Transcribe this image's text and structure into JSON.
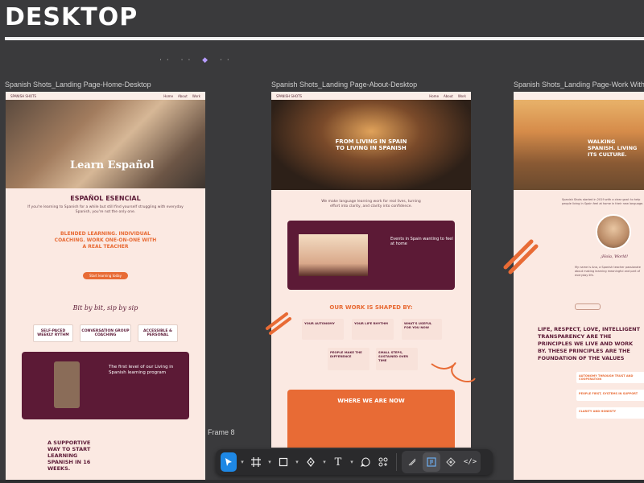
{
  "canvas": {
    "heading": "DESKTOP",
    "frame8_label": "Frame 8"
  },
  "frames": [
    {
      "label": "Spanish Shots_Landing Page-Home-Desktop",
      "logo": "SPANISH SHOTS",
      "hero_text": "Learn Español",
      "section_title": "ESPAÑOL ESENCIAL",
      "blended_text": "BLENDED LEARNING. INDIVIDUAL COACHING. WORK ONE-ON-ONE WITH A REAL TEACHER",
      "tagline": "Bit by bit, sip by sip",
      "features": [
        "SELF-PACED WEEKLY RYTHM",
        "CONVERSATION GROUP COACHING",
        "ACCESSIBLE & PERSONAL"
      ],
      "maroon_title": "The first level of our Living in Spanish learning program",
      "supportive_text": "A SUPPORTIVE WAY TO START LEARNING SPANISH IN 16 WEEKS."
    },
    {
      "label": "Spanish Shots_Landing Page-About-Desktop",
      "logo": "SPANISH SHOTS",
      "hero_text": "FROM LIVING IN SPAIN TO LIVING IN SPANISH",
      "card_title": "Events in Spain wanting to feel at home",
      "section_title": "OUR WORK IS SHAPED BY:",
      "cards": [
        "YOUR AUTONOMY",
        "YOUR LIFE RHYTHM",
        "WHAT'S USEFUL FOR YOU NOW",
        "PEOPLE MAKE THE DIFFERENCE",
        "SMALL STEPS, SUSTAINED OVER TIME"
      ],
      "where_title": "WHERE WE ARE NOW"
    },
    {
      "label": "Spanish Shots_Landing Page-Work With Us-D",
      "hero_text": "WALKING SPANISH. LIVING ITS CULTURE.",
      "greeting": "¡Hola, World!",
      "values_title": "LIFE, RESPECT, LOVE, INTELLIGENT TRANSPARENCY ARE THE PRINCIPLES WE LIVE AND WORK BY. THESE PRINCIPLES ARE THE FOUNDATION OF THE VALUES",
      "value_items": [
        "AUTONOMY THROUGH TRUST AND COOPERATION",
        "PEOPLE FIRST, SYSTEMS IN SUPPORT",
        "CLARITY AND HONESTY"
      ]
    }
  ],
  "toolbar": {
    "tools": [
      "move-tool",
      "frame-tool",
      "shape-tool",
      "pen-tool",
      "text-tool",
      "comment-tool",
      "components-tool"
    ],
    "text_icon": "T",
    "code_icon": "</>"
  }
}
